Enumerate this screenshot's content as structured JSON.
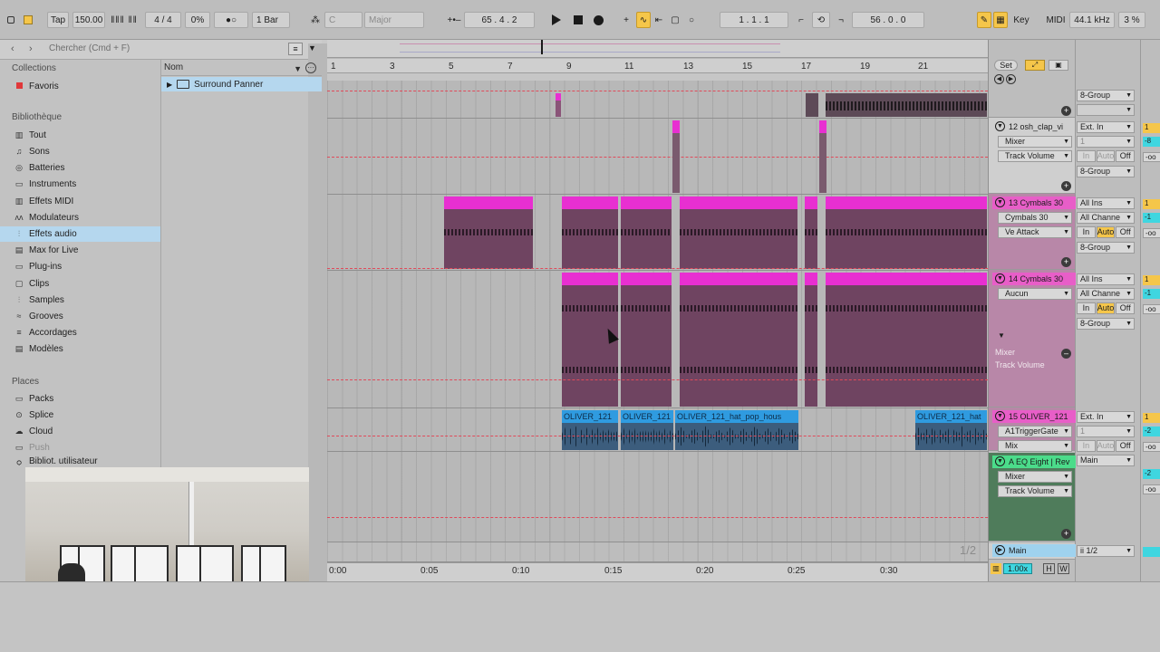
{
  "transport": {
    "tap": "Tap",
    "tempo": "150.00",
    "metro_icon": "metronome-icon",
    "signature": "4 / 4",
    "groove": "0%",
    "follow": "●○",
    "quant": "1 Bar",
    "key_root": "C",
    "scale": "Major",
    "position": "65 .  4 .  2",
    "loop_start": "1 .  1 .  1",
    "loop_length": "56 .  0 .  0",
    "key_label": "Key",
    "midi_label": "MIDI",
    "sample_rate": "44.1 kHz",
    "cpu": "3 %"
  },
  "browser": {
    "search_placeholder": "Chercher (Cmd + F)",
    "collections_title": "Collections",
    "favorites": "Favoris",
    "library_title": "Bibliothèque",
    "library_items": [
      "Tout",
      "Sons",
      "Batteries",
      "Instruments",
      "Effets MIDI",
      "Modulateurs",
      "Effets audio",
      "Max for Live",
      "Plug-ins",
      "Clips",
      "Samples",
      "Grooves",
      "Accordages",
      "Modèles"
    ],
    "places_title": "Places",
    "places_items": [
      "Packs",
      "Splice",
      "Cloud",
      "Push",
      "Bibliot. utilisateur"
    ],
    "column_header": "Nom",
    "result_item": "Surround Panner"
  },
  "ruler": {
    "bars": [
      "1",
      "3",
      "5",
      "7",
      "9",
      "11",
      "13",
      "15",
      "17",
      "19",
      "21"
    ],
    "times": [
      "0:00",
      "0:05",
      "0:10",
      "0:15",
      "0:20",
      "0:25",
      "0:30"
    ],
    "set_label": "Set",
    "page": "1/2",
    "zoom": "1.00x",
    "h_label": "H",
    "w_label": "W"
  },
  "clips": {
    "audio_name": "OLIVER_121",
    "audio_long": "OLIVER_121_hat_pop_hous",
    "audio_end": "OLIVER_121_hat"
  },
  "tracks": [
    {
      "name": "8-Group",
      "color": "#cfcfcf"
    },
    {
      "name": "12 osh_clap_vi",
      "input": "Ext. In",
      "channel": "1",
      "chain": "Mixer",
      "param": "Track Volume",
      "group": "8-Group"
    },
    {
      "name": "13 Cymbals 30",
      "input": "All Ins",
      "channel": "All Channe",
      "chain": "Cymbals 30",
      "param": "Ve Attack",
      "group": "8-Group"
    },
    {
      "name": "14 Cymbals 30",
      "input": "All Ins",
      "channel": "All Channe",
      "chain": "Aucun",
      "param": "",
      "group": "8-Group",
      "lane_device": "Mixer",
      "lane_param": "Track Volume"
    },
    {
      "name": "15 OLIVER_121",
      "input": "Ext. In",
      "channel": "1",
      "chain": "A1TriggerGate",
      "param": "Mix"
    },
    {
      "name": "A EQ Eight | Rev",
      "input": "Main",
      "chain": "Mixer",
      "param": "Track Volume"
    },
    {
      "name": "Main",
      "input": "ii 1/2"
    }
  ],
  "monitor": {
    "in": "In",
    "auto": "Auto",
    "off": "Off"
  },
  "meters": [
    "1",
    "-8",
    "1",
    "-1",
    "1",
    "-1",
    "-2",
    "-2",
    "-oo"
  ],
  "colors": {
    "midi_clip": "#e82fd1",
    "audio_clip": "#2f9be0",
    "accent": "#f5c64a"
  }
}
